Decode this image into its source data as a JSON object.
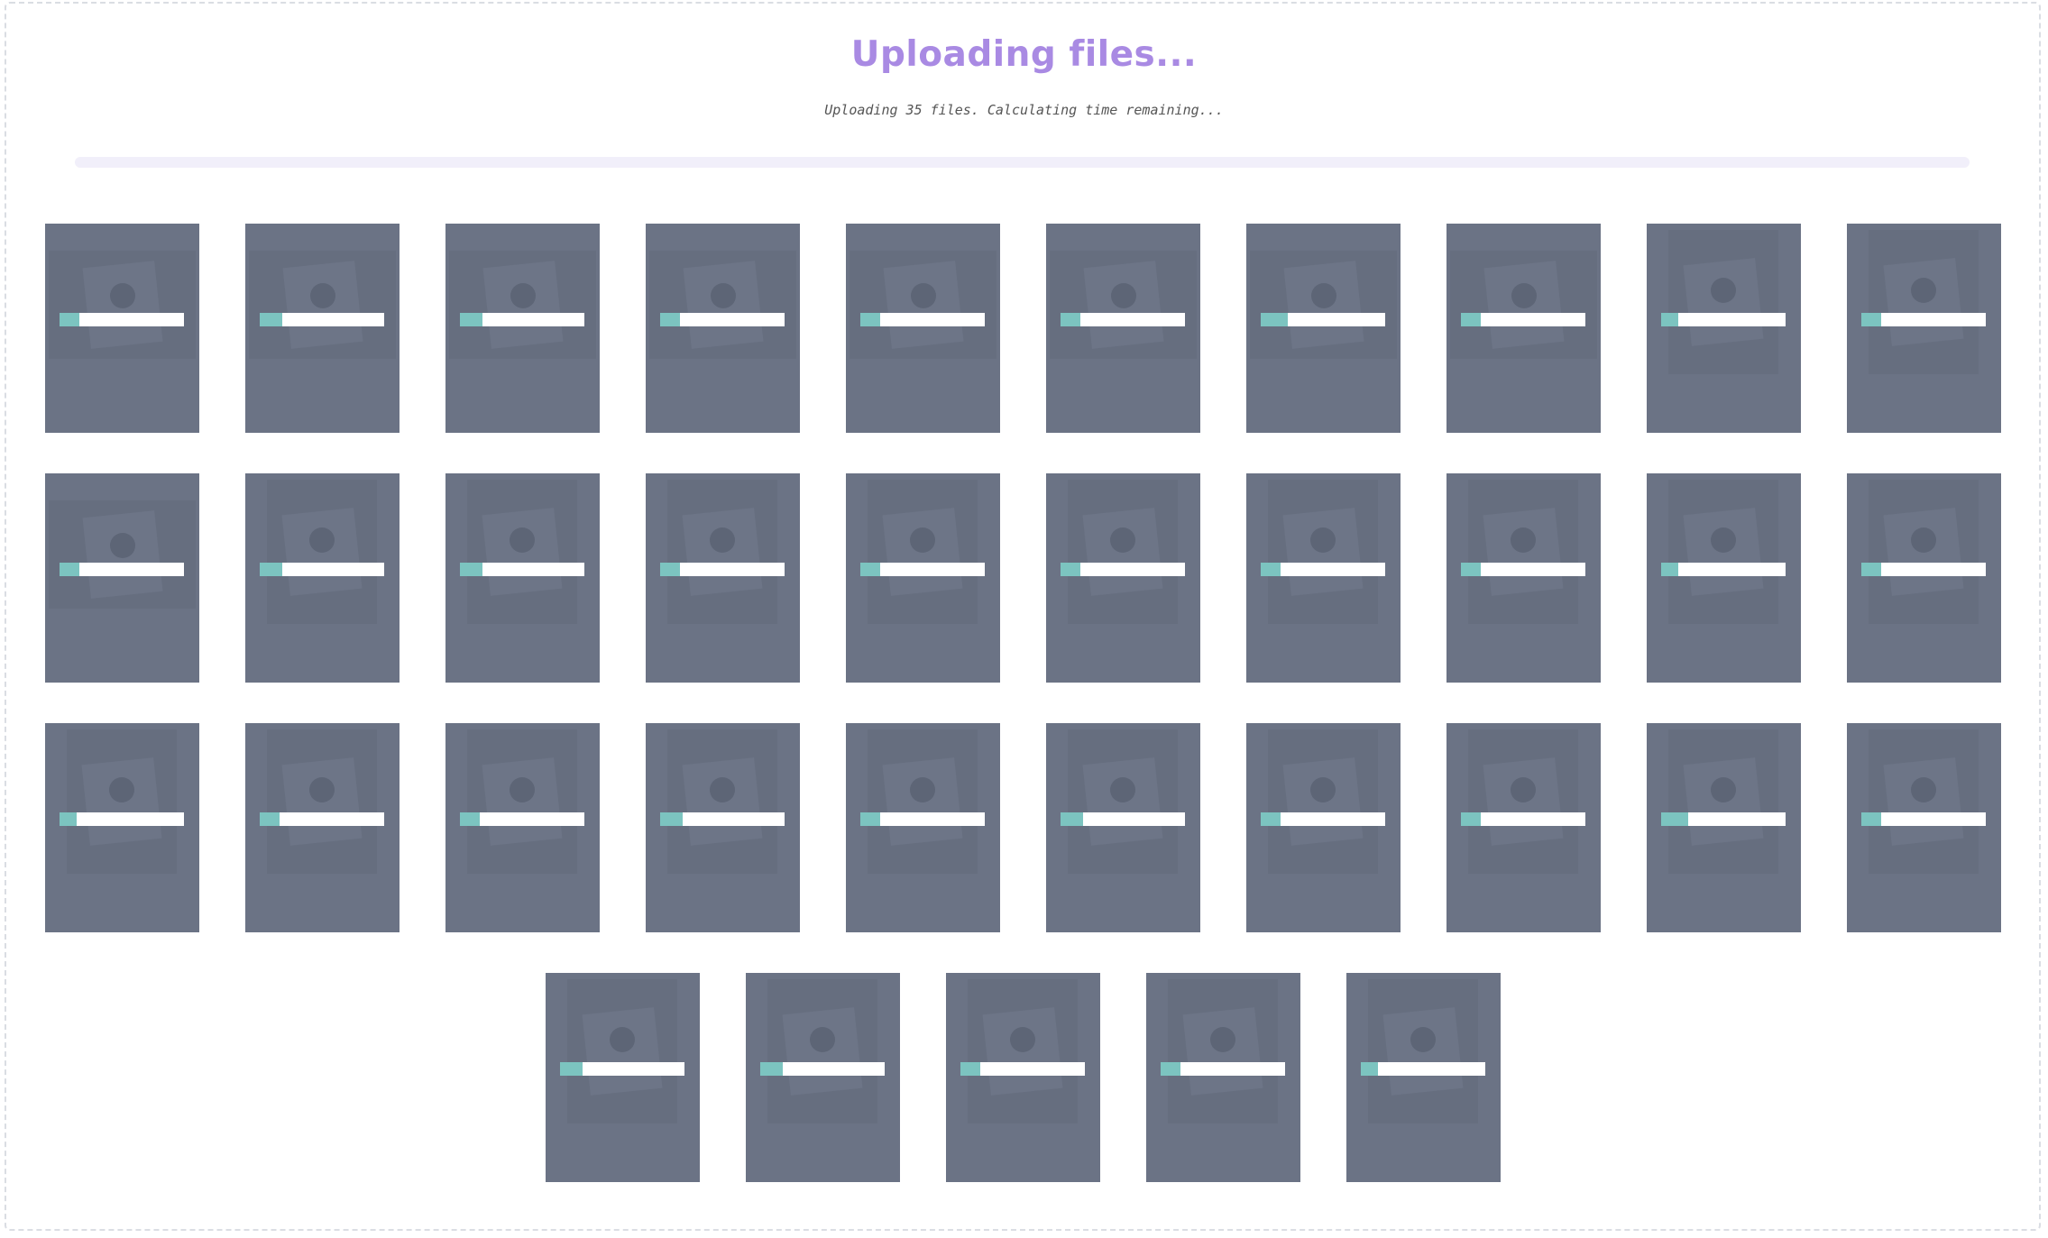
{
  "header": {
    "title": "Uploading files...",
    "subtitle": "Uploading 35 files. Calculating time remaining..."
  },
  "overall_progress": 0,
  "colors": {
    "accent": "#a98ae3",
    "tile_bg": "#6b7385",
    "bar_fill": "#7cc4c0",
    "bar_track": "#ffffff"
  },
  "files": [
    {
      "name": "",
      "progress": 0.16,
      "orientation": "landscape"
    },
    {
      "name": "",
      "progress": 0.18,
      "orientation": "landscape"
    },
    {
      "name": "",
      "progress": 0.18,
      "orientation": "landscape"
    },
    {
      "name": "",
      "progress": 0.16,
      "orientation": "landscape"
    },
    {
      "name": "",
      "progress": 0.16,
      "orientation": "landscape"
    },
    {
      "name": "",
      "progress": 0.16,
      "orientation": "landscape"
    },
    {
      "name": "",
      "progress": 0.22,
      "orientation": "landscape"
    },
    {
      "name": "",
      "progress": 0.16,
      "orientation": "landscape"
    },
    {
      "name": "",
      "progress": 0.14,
      "orientation": "portrait"
    },
    {
      "name": "",
      "progress": 0.16,
      "orientation": "portrait"
    },
    {
      "name": "",
      "progress": 0.16,
      "orientation": "landscape"
    },
    {
      "name": "",
      "progress": 0.18,
      "orientation": "portrait"
    },
    {
      "name": "",
      "progress": 0.18,
      "orientation": "portrait"
    },
    {
      "name": "",
      "progress": 0.16,
      "orientation": "portrait"
    },
    {
      "name": "",
      "progress": 0.16,
      "orientation": "portrait"
    },
    {
      "name": "",
      "progress": 0.16,
      "orientation": "portrait"
    },
    {
      "name": "",
      "progress": 0.16,
      "orientation": "portrait"
    },
    {
      "name": "",
      "progress": 0.16,
      "orientation": "portrait"
    },
    {
      "name": "",
      "progress": 0.14,
      "orientation": "portrait"
    },
    {
      "name": "",
      "progress": 0.16,
      "orientation": "portrait"
    },
    {
      "name": "",
      "progress": 0.14,
      "orientation": "portrait"
    },
    {
      "name": "",
      "progress": 0.16,
      "orientation": "portrait"
    },
    {
      "name": "",
      "progress": 0.16,
      "orientation": "portrait"
    },
    {
      "name": "",
      "progress": 0.18,
      "orientation": "portrait"
    },
    {
      "name": "",
      "progress": 0.16,
      "orientation": "portrait"
    },
    {
      "name": "",
      "progress": 0.18,
      "orientation": "portrait"
    },
    {
      "name": "",
      "progress": 0.16,
      "orientation": "portrait"
    },
    {
      "name": "",
      "progress": 0.16,
      "orientation": "portrait"
    },
    {
      "name": "",
      "progress": 0.22,
      "orientation": "portrait"
    },
    {
      "name": "",
      "progress": 0.16,
      "orientation": "portrait"
    },
    {
      "name": "",
      "progress": 0.18,
      "orientation": "portrait"
    },
    {
      "name": "",
      "progress": 0.18,
      "orientation": "portrait"
    },
    {
      "name": "",
      "progress": 0.16,
      "orientation": "portrait"
    },
    {
      "name": "",
      "progress": 0.16,
      "orientation": "portrait"
    },
    {
      "name": "",
      "progress": 0.14,
      "orientation": "portrait"
    }
  ]
}
